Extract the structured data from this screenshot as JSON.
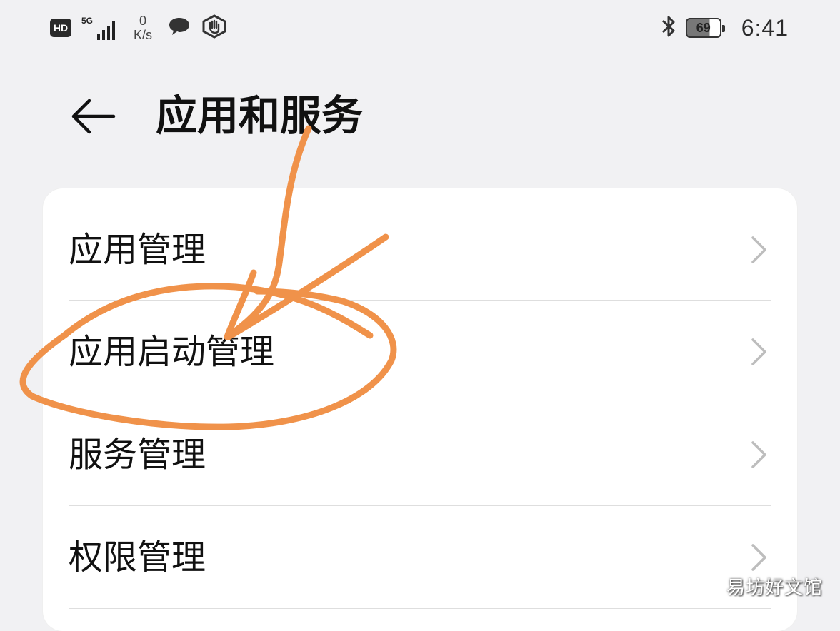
{
  "status_bar": {
    "hd_label": "HD",
    "network_label": "5G",
    "speed_value": "0",
    "speed_unit": "K/s",
    "battery_level": "69",
    "time": "6:41",
    "icons": [
      "hd-icon",
      "signal-icon",
      "chat-icon",
      "hand-shield-icon",
      "bluetooth-icon",
      "battery-icon"
    ]
  },
  "header": {
    "back_icon": "arrow-left-icon",
    "title": "应用和服务"
  },
  "menu": {
    "items": [
      {
        "label": "应用管理",
        "icon": "chevron-right-icon"
      },
      {
        "label": "应用启动管理",
        "icon": "chevron-right-icon"
      },
      {
        "label": "服务管理",
        "icon": "chevron-right-icon"
      },
      {
        "label": "权限管理",
        "icon": "chevron-right-icon"
      }
    ]
  },
  "annotation": {
    "color": "#f0924a"
  },
  "watermark": "易坊好文馆",
  "colors": {
    "background": "#f1f1f3",
    "card": "#ffffff",
    "divider": "#dedede",
    "chevron": "#bdbdbd"
  }
}
